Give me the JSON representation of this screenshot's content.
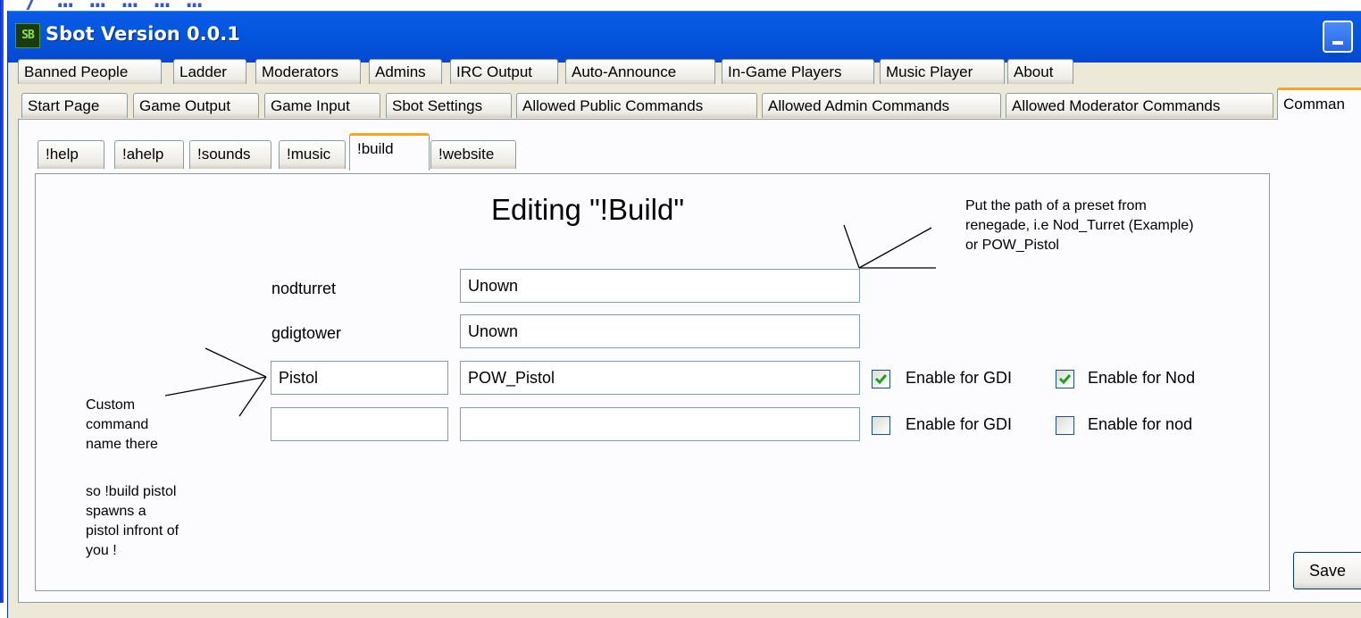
{
  "crop_text": "/ … … … … …",
  "window": {
    "title": "Sbot Version 0.0.1",
    "app_icon": "SB",
    "minimize_label": ""
  },
  "tabs_row1": [
    "Banned People",
    "Ladder",
    "Moderators",
    "Admins",
    "IRC Output",
    "Auto-Announce",
    "In-Game Players",
    "Music Player",
    "About"
  ],
  "tabs_row2": [
    "Start Page",
    "Game Output",
    "Game Input",
    "Sbot Settings",
    "Allowed Public Commands",
    "Allowed Admin Commands",
    "Allowed Moderator Commands",
    "Comman"
  ],
  "subtabs": [
    "!help",
    "!ahelp",
    "!sounds",
    "!music",
    "!build",
    "!website"
  ],
  "active_subtab": "!build",
  "editor": {
    "heading": "Editing \"!Build\"",
    "rows": [
      {
        "name": "nodturret",
        "preset": "Unown"
      },
      {
        "name": "gdigtower",
        "preset": "Unown"
      },
      {
        "name": "Pistol",
        "preset": "POW_Pistol",
        "gdi_label": "Enable for GDI",
        "gdi_checked": true,
        "nod_label": "Enable for Nod",
        "nod_checked": true
      },
      {
        "name": "",
        "preset": "",
        "gdi_label": "Enable for GDI",
        "gdi_checked": false,
        "nod_label": "Enable for nod",
        "nod_checked": false
      }
    ]
  },
  "annotations": {
    "preset_note": [
      "Put the path of a preset from",
      "renegade, i.e Nod_Turret (Example)",
      "or POW_Pistol"
    ],
    "custom_note": [
      "Custom",
      "command",
      "name there"
    ],
    "example_note": [
      "so !build pistol",
      "spawns a",
      "pistol infront of",
      "you !"
    ]
  },
  "save_button": "Save",
  "colors": {
    "titlebar": "#0458e0",
    "active_tab_accent": "#f5a623",
    "checkmark": "#21a121"
  }
}
